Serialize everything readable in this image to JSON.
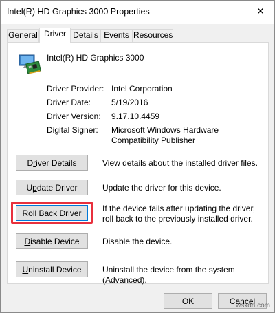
{
  "window": {
    "title": "Intel(R) HD Graphics 3000 Properties",
    "close_glyph": "✕"
  },
  "tabs": [
    {
      "label": "General",
      "active": false
    },
    {
      "label": "Driver",
      "active": true
    },
    {
      "label": "Details",
      "active": false
    },
    {
      "label": "Events",
      "active": false
    },
    {
      "label": "Resources",
      "active": false
    }
  ],
  "driver": {
    "device_icon": "display-adapter-icon",
    "device_name": "Intel(R) HD Graphics 3000",
    "properties": [
      {
        "label": "Driver Provider:",
        "value": "Intel Corporation"
      },
      {
        "label": "Driver Date:",
        "value": "5/19/2016"
      },
      {
        "label": "Driver Version:",
        "value": "9.17.10.4459"
      },
      {
        "label": "Digital Signer:",
        "value": "Microsoft Windows Hardware Compatibility Publisher"
      }
    ],
    "actions": [
      {
        "label": "Driver Details",
        "mnemonic_index": 1,
        "description": "View details about the installed driver files."
      },
      {
        "label": "Update Driver",
        "mnemonic_index": 1,
        "description": "Update the driver for this device."
      },
      {
        "label": "Roll Back Driver",
        "mnemonic_index": 0,
        "description": "If the device fails after updating the driver, roll back to the previously installed driver.",
        "highlighted": true,
        "highlight_color": "#e8303d"
      },
      {
        "label": "Disable Device",
        "mnemonic_index": 0,
        "description": "Disable the device."
      },
      {
        "label": "Uninstall Device",
        "mnemonic_index": 0,
        "description": "Uninstall the device from the system (Advanced)."
      }
    ]
  },
  "footer": {
    "ok_label": "OK",
    "cancel_label": "Cancel"
  },
  "watermark": "wsxdn.com",
  "colors": {
    "highlight": "#e8303d",
    "focus": "#0078d7",
    "panel": "#ffffff",
    "dialog": "#f0f0f0"
  }
}
